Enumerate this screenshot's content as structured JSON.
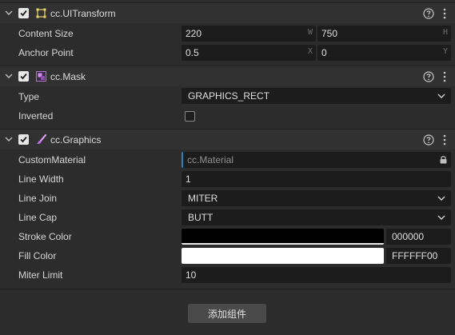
{
  "ui_transform": {
    "title": "cc.UITransform",
    "content_size": {
      "label": "Content Size",
      "w": "220",
      "w_suffix": "W",
      "h": "750",
      "h_suffix": "H"
    },
    "anchor_point": {
      "label": "Anchor Point",
      "x": "0.5",
      "x_suffix": "X",
      "y": "0",
      "y_suffix": "Y"
    }
  },
  "mask": {
    "title": "cc.Mask",
    "type": {
      "label": "Type",
      "value": "GRAPHICS_RECT"
    },
    "inverted": {
      "label": "Inverted",
      "checked": false
    }
  },
  "graphics": {
    "title": "cc.Graphics",
    "custom_material": {
      "label": "CustomMaterial",
      "placeholder": "cc.Material"
    },
    "line_width": {
      "label": "Line Width",
      "value": "1"
    },
    "line_join": {
      "label": "Line Join",
      "value": "MITER"
    },
    "line_cap": {
      "label": "Line Cap",
      "value": "BUTT"
    },
    "stroke_color": {
      "label": "Stroke Color",
      "hex": "000000",
      "color": "#000000"
    },
    "fill_color": {
      "label": "Fill Color",
      "hex": "FFFFFF00",
      "color": "#ffffff"
    },
    "miter_limit": {
      "label": "Miter Limit",
      "value": "10"
    }
  },
  "add_component": {
    "label": "添加组件"
  },
  "colors": {
    "panel_bg": "#2c2c2c",
    "header_bg": "#313131",
    "field_bg": "#1c1c1c",
    "asset_accent": "#2d7fb8",
    "graphics_icon": "#c86cf0",
    "mask_icon": "#b070d8",
    "transform_icon": "#e6d36a"
  }
}
